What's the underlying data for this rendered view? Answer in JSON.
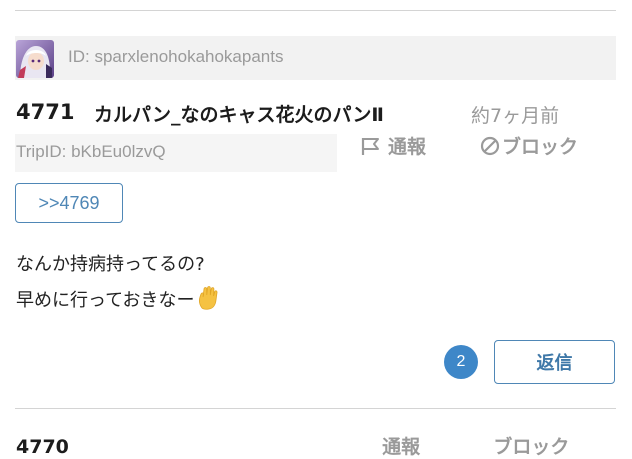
{
  "post": {
    "user_id": "ID: sparxlenohokahokapants",
    "number": "4771",
    "name": "カルパン_なのキャス花火のパンⅡ",
    "time": "約7ヶ月前",
    "trip_id": "TripID: bKbEu0lzvQ",
    "report_label": "通報",
    "block_label": "ブロック",
    "anchor": ">>4769",
    "body_lines": [
      "なんか持病持ってるの?",
      "早めに行っておきなー"
    ],
    "reply_count": "2",
    "reply_label": "返信"
  },
  "next_post": {
    "number": "4770",
    "report_label": "通報",
    "block_label": "ブロック"
  },
  "colors": {
    "accent": "#4f87b6",
    "badge": "#3e87c8",
    "muted": "#9a9a9a",
    "id_bar": "#f2f2f2"
  },
  "icons": {
    "report": "flag-icon",
    "block": "block-icon",
    "emoji": "raised-hand-emoji"
  }
}
